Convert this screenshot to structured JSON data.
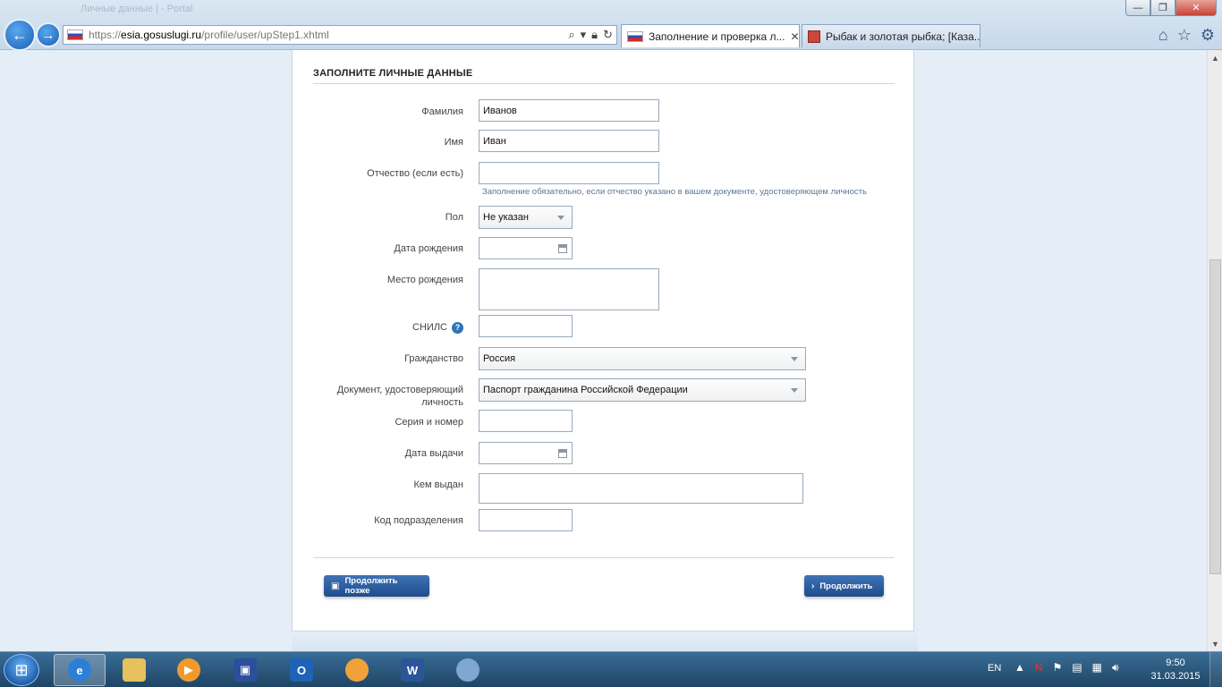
{
  "browser": {
    "ghost_title": "Личные данные | - Portal",
    "url_prefix": "https://",
    "url_host": "esia.gosuslugi.ru",
    "url_path": "/profile/user/upStep1.xhtml",
    "tabs": [
      {
        "label": "Заполнение и проверка л...",
        "active": true
      },
      {
        "label": "Рыбак и золотая рыбка; [Каза...",
        "active": false
      }
    ]
  },
  "form": {
    "section_title": "ЗАПОЛНИТЕ ЛИЧНЫЕ ДАННЫЕ",
    "fields": {
      "surname": {
        "label": "Фамилия",
        "value": "Иванов"
      },
      "name": {
        "label": "Имя",
        "value": "Иван"
      },
      "patronymic": {
        "label": "Отчество (если есть)",
        "value": "",
        "hint": "Заполнение обязательно, если отчество указано в вашем документе, удостоверяющем личность"
      },
      "gender": {
        "label": "Пол",
        "value": "Не указан"
      },
      "birth_date": {
        "label": "Дата рождения",
        "value": ""
      },
      "birth_place": {
        "label": "Место рождения",
        "value": ""
      },
      "snils": {
        "label": "СНИЛС",
        "value": ""
      },
      "citizenship": {
        "label": "Гражданство",
        "value": "Россия"
      },
      "document": {
        "label": "Документ, удостоверяющий личность",
        "value": "Паспорт гражданина Российской Федерации"
      },
      "series_number": {
        "label": "Серия и номер",
        "value": ""
      },
      "issue_date": {
        "label": "Дата выдачи",
        "value": ""
      },
      "issued_by": {
        "label": "Кем выдан",
        "value": ""
      },
      "division_code": {
        "label": "Код подразделения",
        "value": ""
      }
    },
    "buttons": {
      "later": "Продолжить позже",
      "next": "Продолжить"
    }
  },
  "taskbar": {
    "lang": "EN",
    "time": "9:50",
    "date": "31.03.2015"
  }
}
